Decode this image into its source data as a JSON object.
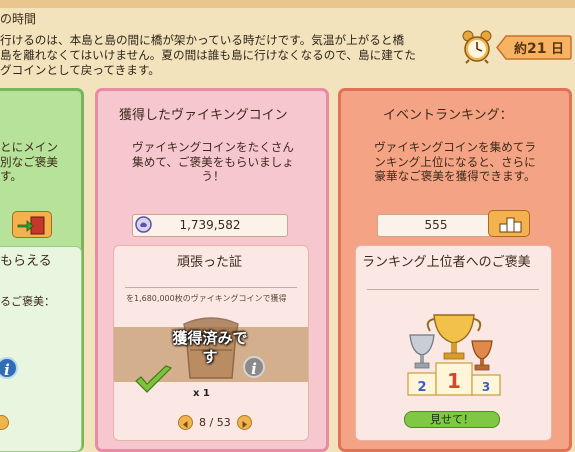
{
  "header": {
    "title": "の時間",
    "desc_lines": [
      "行けるのは、本島と島の間に橋が架かっている時だけです。気温が上がると橋",
      "島を離れなくてはいけません。夏の間は誰も島に行けなくなるので、島に建てた",
      "グコインとして戻ってきます。"
    ],
    "days_prefix": "約",
    "days_value": "21",
    "days_suffix": "日"
  },
  "left_card": {
    "desc_lines": [
      "とにメイン",
      "別なご褒美",
      "す。"
    ],
    "subpanel_title": "もらえる",
    "subpanel_text": "るご褒美："
  },
  "coin_card": {
    "title": "獲得したヴァイキングコイン",
    "desc_lines": [
      "ヴァイキングコインをたくさん",
      "集めて、ご褒美をもらいましょ",
      "う！"
    ],
    "coin_total": "1,739,582",
    "reward": {
      "title": "頑張った証",
      "requirement": "を1,680,000枚のヴァイキングコインで獲得",
      "status_line1": "獲得済みで",
      "status_line2": "す",
      "quantity": "x 1",
      "pager": "8 / 53"
    }
  },
  "ranking_card": {
    "title": "イベントランキング：",
    "desc_lines": [
      "ヴァイキングコインを集めてラ",
      "ンキング上位になると、さらに",
      "豪華なご褒美を獲得できます。"
    ],
    "rank_value": "555",
    "reward_title": "ランキング上位者へのご褒美",
    "podium_numbers": [
      "2",
      "1",
      "3"
    ],
    "show_button": "見せて！"
  },
  "colors": {
    "green_card": "#b6e29a",
    "pink_card": "#f7c7d0",
    "red_card": "#f4a484",
    "gold": "#e8a53a"
  }
}
